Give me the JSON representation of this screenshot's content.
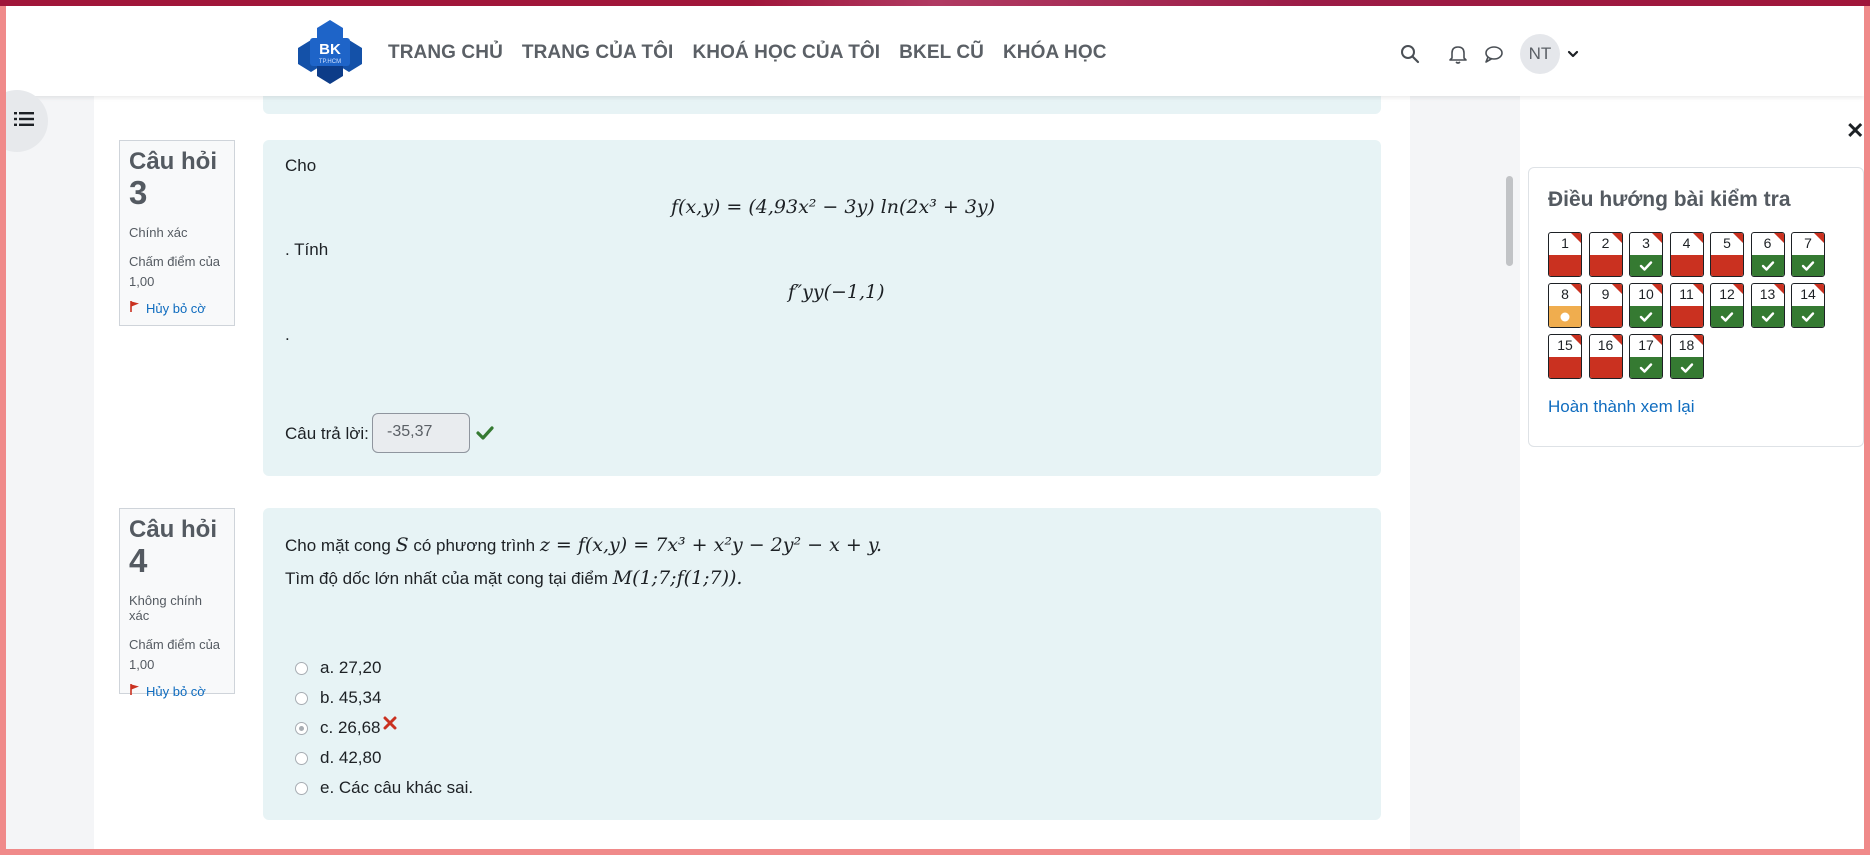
{
  "header": {
    "nav": [
      "TRANG CHỦ",
      "TRANG CỦA TÔI",
      "KHOÁ HỌC CỦA TÔI",
      "BKEL CŨ",
      "KHÓA HỌC"
    ],
    "logo_text": "BK",
    "logo_sub": "TP.HCM",
    "avatar": "NT",
    "icons": [
      "search-icon",
      "bell-icon",
      "chat-icon",
      "chevron-down-icon"
    ]
  },
  "questions": [
    {
      "word": "Câu hỏi",
      "number": "3",
      "state": "Chính xác",
      "grade": "Chấm điểm của 1,00",
      "flag_label": "Hủy bỏ cờ",
      "intro": "Cho",
      "formula": "f(x,y) = (4,93x² − 3y) ln(2x³ + 3y)",
      "mid_text": ". Tính",
      "target": "f″yy(−1,1)",
      "end_text": ".",
      "answer_label": "Câu trả lời:",
      "answer_value": "-35,37"
    },
    {
      "word": "Câu hỏi",
      "number": "4",
      "state": "Không chính xác",
      "grade": "Chấm điểm của 1,00",
      "flag_label": "Hủy bỏ cờ",
      "line1_text": "Cho mặt cong",
      "line1_var": "S",
      "line1_mid": "có phương trình",
      "line1_formula": "z = f(x,y) = 7x³ + x²y − 2y² − x + y.",
      "line2_text": "Tìm độ dốc lớn nhất của mặt cong tại điểm",
      "line2_formula": "M(1;7;f(1;7)).",
      "options": [
        "a. 27,20",
        "b. 45,34",
        "c. 26,68",
        "d. 42,80",
        "e. Các câu khác sai."
      ],
      "selected": 2
    }
  ],
  "quiz_nav": {
    "title": "Điều hướng bài kiểm tra",
    "items": [
      {
        "n": "1",
        "status": "incorrect"
      },
      {
        "n": "2",
        "status": "incorrect"
      },
      {
        "n": "3",
        "status": "correct"
      },
      {
        "n": "4",
        "status": "incorrect"
      },
      {
        "n": "5",
        "status": "incorrect"
      },
      {
        "n": "6",
        "status": "correct"
      },
      {
        "n": "7",
        "status": "correct"
      },
      {
        "n": "8",
        "status": "partial"
      },
      {
        "n": "9",
        "status": "incorrect"
      },
      {
        "n": "10",
        "status": "correct"
      },
      {
        "n": "11",
        "status": "incorrect"
      },
      {
        "n": "12",
        "status": "correct"
      },
      {
        "n": "13",
        "status": "correct"
      },
      {
        "n": "14",
        "status": "correct"
      },
      {
        "n": "15",
        "status": "incorrect"
      },
      {
        "n": "16",
        "status": "incorrect"
      },
      {
        "n": "17",
        "status": "correct"
      },
      {
        "n": "18",
        "status": "correct"
      }
    ],
    "finish_label": "Hoàn thành xem lại"
  },
  "colors": {
    "correct": "#357a32",
    "incorrect": "#ca3120",
    "partial": "#f0ad4e",
    "link": "#0f6cbf",
    "card_bg": "#e7f3f5"
  }
}
